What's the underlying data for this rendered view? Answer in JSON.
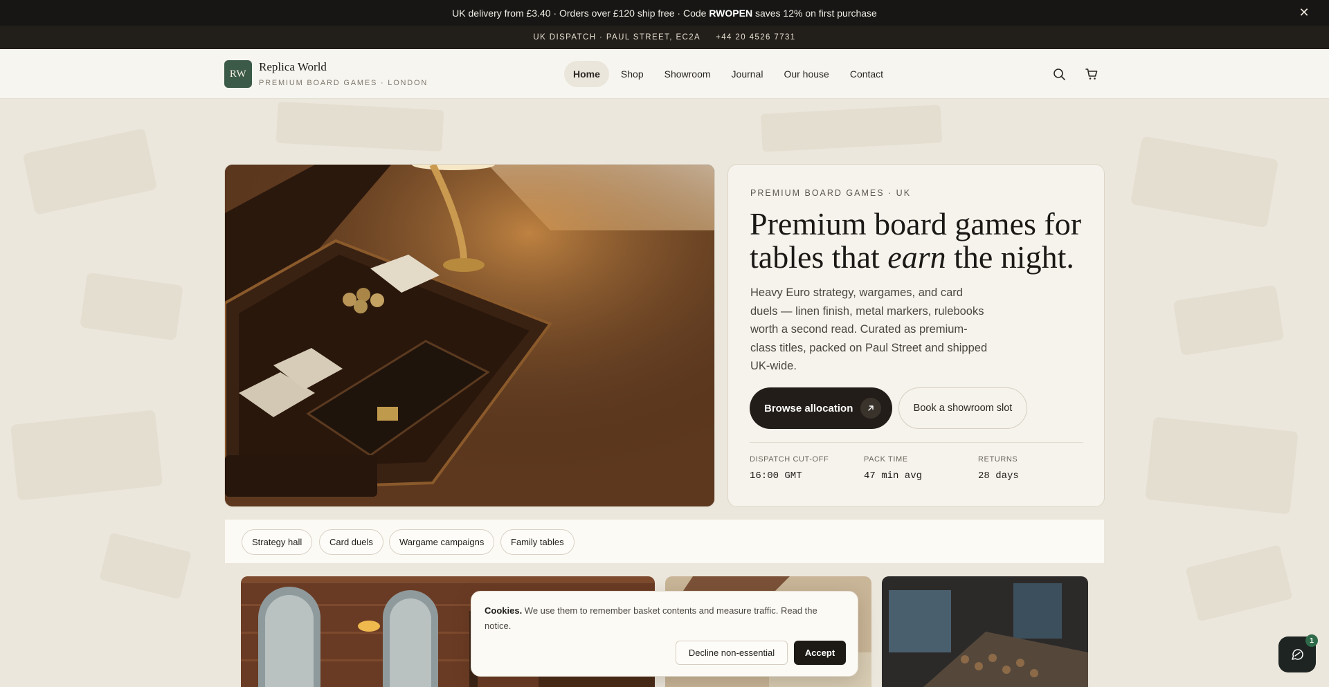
{
  "promo": {
    "text_before": "UK delivery from £3.40 · Orders over £120 ship free · Code ",
    "code": "RWOPEN",
    "text_after": " saves 12% on first purchase",
    "close_glyph": "✕"
  },
  "dispatch": {
    "address": "UK DISPATCH · PAUL STREET, EC2A",
    "phone": "+44 20 4526 7731"
  },
  "brand": {
    "mark": "RW",
    "name": "Replica World",
    "tagline": "PREMIUM BOARD GAMES · LONDON"
  },
  "nav": {
    "items": [
      {
        "label": "Home",
        "active": true
      },
      {
        "label": "Shop"
      },
      {
        "label": "Showroom"
      },
      {
        "label": "Journal"
      },
      {
        "label": "Our house"
      },
      {
        "label": "Contact"
      }
    ],
    "icons": [
      "search-icon",
      "cart-icon"
    ]
  },
  "hero": {
    "eyebrow": "PREMIUM BOARD GAMES · UK",
    "title_part1": "Premium board games for tables that ",
    "title_emphasis": "earn",
    "title_part2": " the night.",
    "description": "Heavy Euro strategy, wargames, and card duels — linen finish, metal markers, rulebooks worth a second read. Curated as premium-class titles, packed on Paul Street and shipped UK-wide.",
    "primary_cta": "Browse allocation",
    "secondary_cta": "Book a showroom slot",
    "stats": [
      {
        "label": "DISPATCH CUT-OFF",
        "value": "16:00 GMT"
      },
      {
        "label": "PACK TIME",
        "value": "47 min avg"
      },
      {
        "label": "RETURNS",
        "value": "28 days"
      }
    ]
  },
  "chips": [
    "Strategy hall",
    "Card duels",
    "Wargame campaigns",
    "Family tables"
  ],
  "cookie": {
    "title": "Cookies.",
    "text": " We use them to remember basket contents and measure traffic. Read the notice.",
    "decline": "Decline non-essential",
    "accept": "Accept"
  },
  "chat": {
    "badge": "1"
  },
  "colors": {
    "promo_bg": "#171615",
    "brand_green": "#3c5a48",
    "button_dark": "#221d18",
    "page_bg": "#efebe2"
  }
}
